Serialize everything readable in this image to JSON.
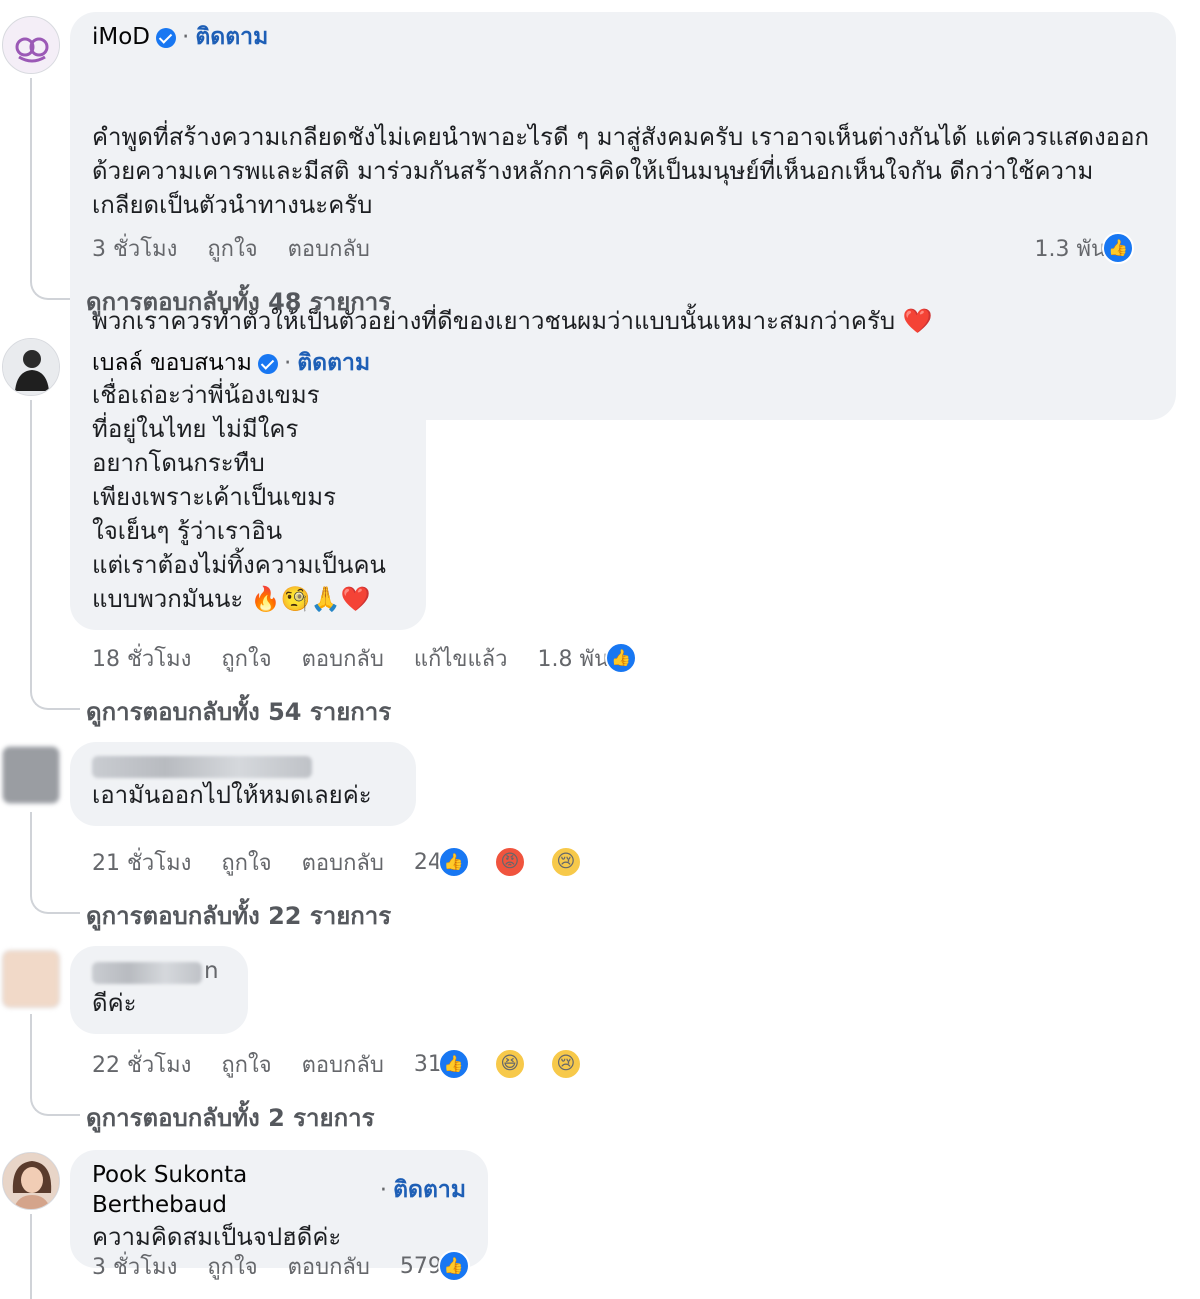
{
  "comments": [
    {
      "name": "iMoD",
      "verified": true,
      "follow": "ติดตาม",
      "paragraphs": [
        "คำพูดที่สร้างความเกลียดชังไม่เคยนำพาอะไรดี ๆ มาสู่สังคมครับ เราอาจเห็นต่างกันได้ แต่ควรแสดงออกด้วยความเคารพและมีสติ มาร่วมกันสร้างหลักการคิดให้เป็นมนุษย์ที่เห็นอกเห็นใจกัน ดีกว่าใช้ความเกลียดเป็นตัวนำทางนะครับ",
        "พวกเราควรทำตัวให้เป็นตัวอย่างที่ดีของเยาวชนผมว่าแบบนั้นเหมาะสมกว่าครับ ❤️"
      ],
      "time": "3 ชั่วโมง",
      "like": "ถูกใจ",
      "reply": "ตอบกลับ",
      "reaction_count": "1.3 พัน",
      "view_replies": "ดูการตอบกลับทั้ง 48 รายการ"
    },
    {
      "name": "เบลล์ ขอบสนาม",
      "verified": true,
      "follow": "ติดตาม",
      "text": "เชื่อเถ่อะว่าพี่น้องเขมร\nที่อยู่ในไทย ไม่มีใคร\nอยากโดนกระทืบ\nเพียงเพราะเค้าเป็นเขมร\nใจเย็นๆ รู้ว่าเราอิน\nแต่เราต้องไม่ทิ้งความเป็นคน\nแบบพวกมันนะ 🔥🧐🙏❤️",
      "time": "18 ชั่วโมง",
      "like": "ถูกใจ",
      "reply": "ตอบกลับ",
      "edited": "แก้ไขแล้ว",
      "reaction_count": "1.8 พัน",
      "view_replies": "ดูการตอบกลับทั้ง 54 รายการ"
    },
    {
      "text": "เอามันออกไปให้หมดเลยค่ะ",
      "time": "21 ชั่วโมง",
      "like": "ถูกใจ",
      "reply": "ตอบกลับ",
      "reaction_count": "24",
      "view_replies": "ดูการตอบกลับทั้ง 22 รายการ"
    },
    {
      "name_tail": "n",
      "text": "ดีค่ะ",
      "time": "22 ชั่วโมง",
      "like": "ถูกใจ",
      "reply": "ตอบกลับ",
      "reaction_count": "31",
      "view_replies": "ดูการตอบกลับทั้ง 2 รายการ"
    },
    {
      "name": "Pook Sukonta Berthebaud",
      "follow": "ติดตาม",
      "text": "ความคิดสมเป็นจปฮดีค่ะ",
      "time": "3 ชั่วโมง",
      "like": "ถูกใจ",
      "reply": "ตอบกลับ",
      "reaction_count": "579"
    }
  ],
  "icons": {
    "like": "like-thumb-icon",
    "angry": "angry-emoji-icon",
    "sad": "sad-emoji-icon",
    "haha": "haha-emoji-icon",
    "verified": "verified-badge-icon"
  },
  "colors": {
    "bubble": "#f0f2f5",
    "follow": "#1e5fb6",
    "like_blue": "#1877f2",
    "meta": "#65676b"
  }
}
